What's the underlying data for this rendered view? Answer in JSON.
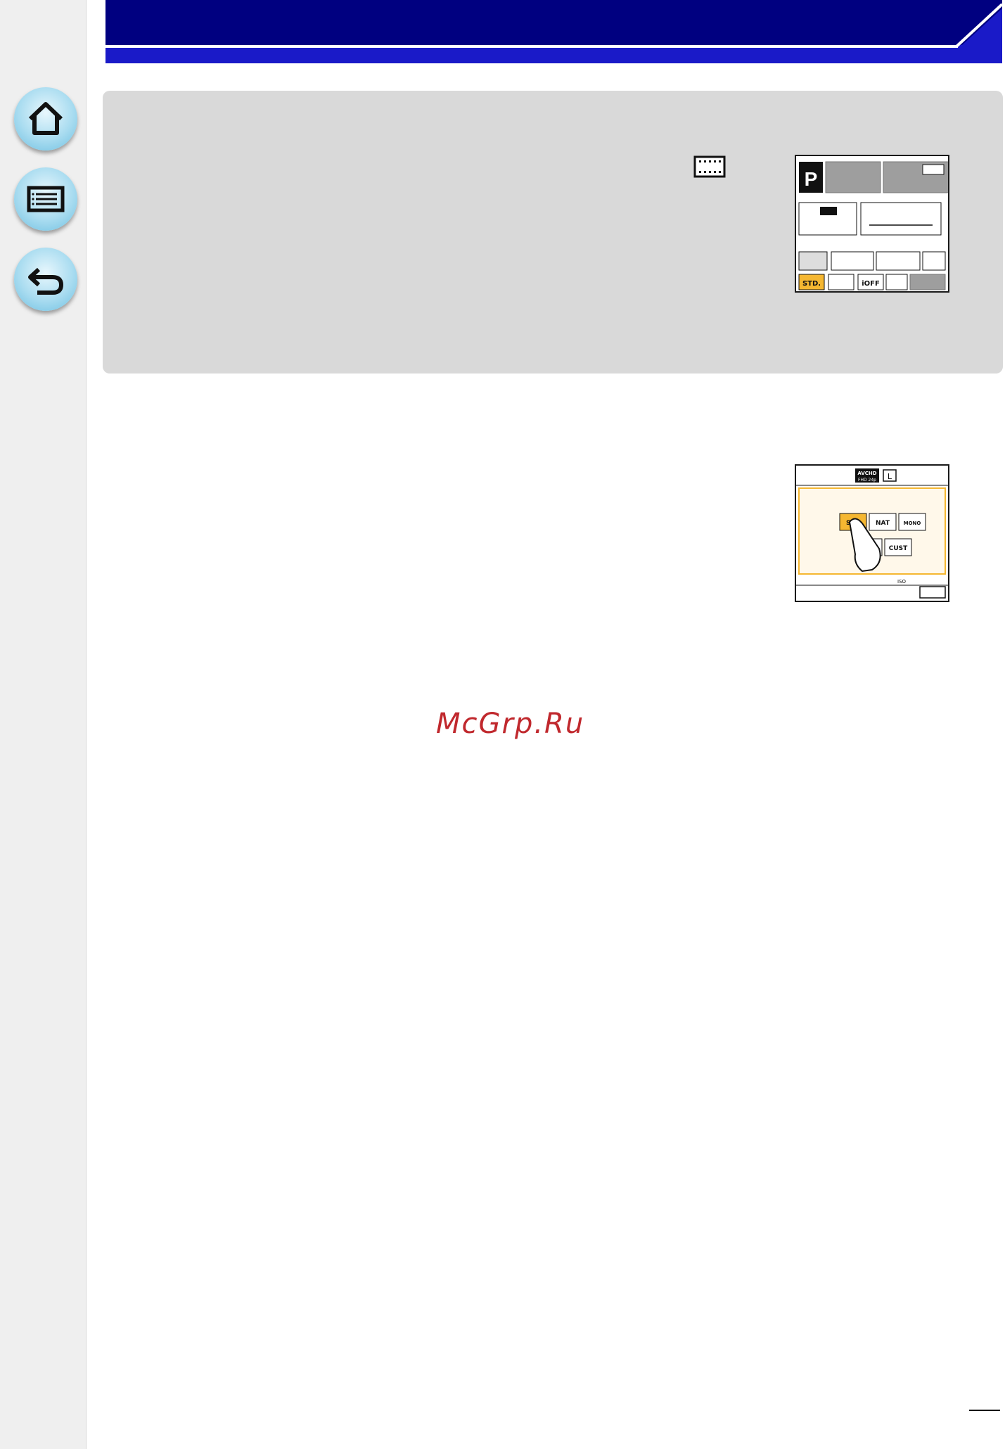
{
  "nav": {
    "home_icon": "home-icon",
    "menu_icon": "list-menu-icon",
    "back_icon": "return-arrow-icon"
  },
  "colors": {
    "header_dark": "#000080",
    "header_light": "#1a1ac8",
    "panel": "#d9d9d9",
    "sidebar": "#efefef",
    "highlight": "#f5b731",
    "watermark": "#c0282d"
  },
  "screen1": {
    "mode": "P",
    "highlighted_icon": "STD.",
    "bottom_icon": "iOFF"
  },
  "screen2": {
    "top_icons": [
      "AVCHD",
      "FHD 24p",
      "L"
    ],
    "styles": [
      "STD",
      "NAT",
      "MONO",
      "CUST"
    ],
    "bottom_icon": "ISO"
  },
  "watermark": "McGrp.Ru"
}
